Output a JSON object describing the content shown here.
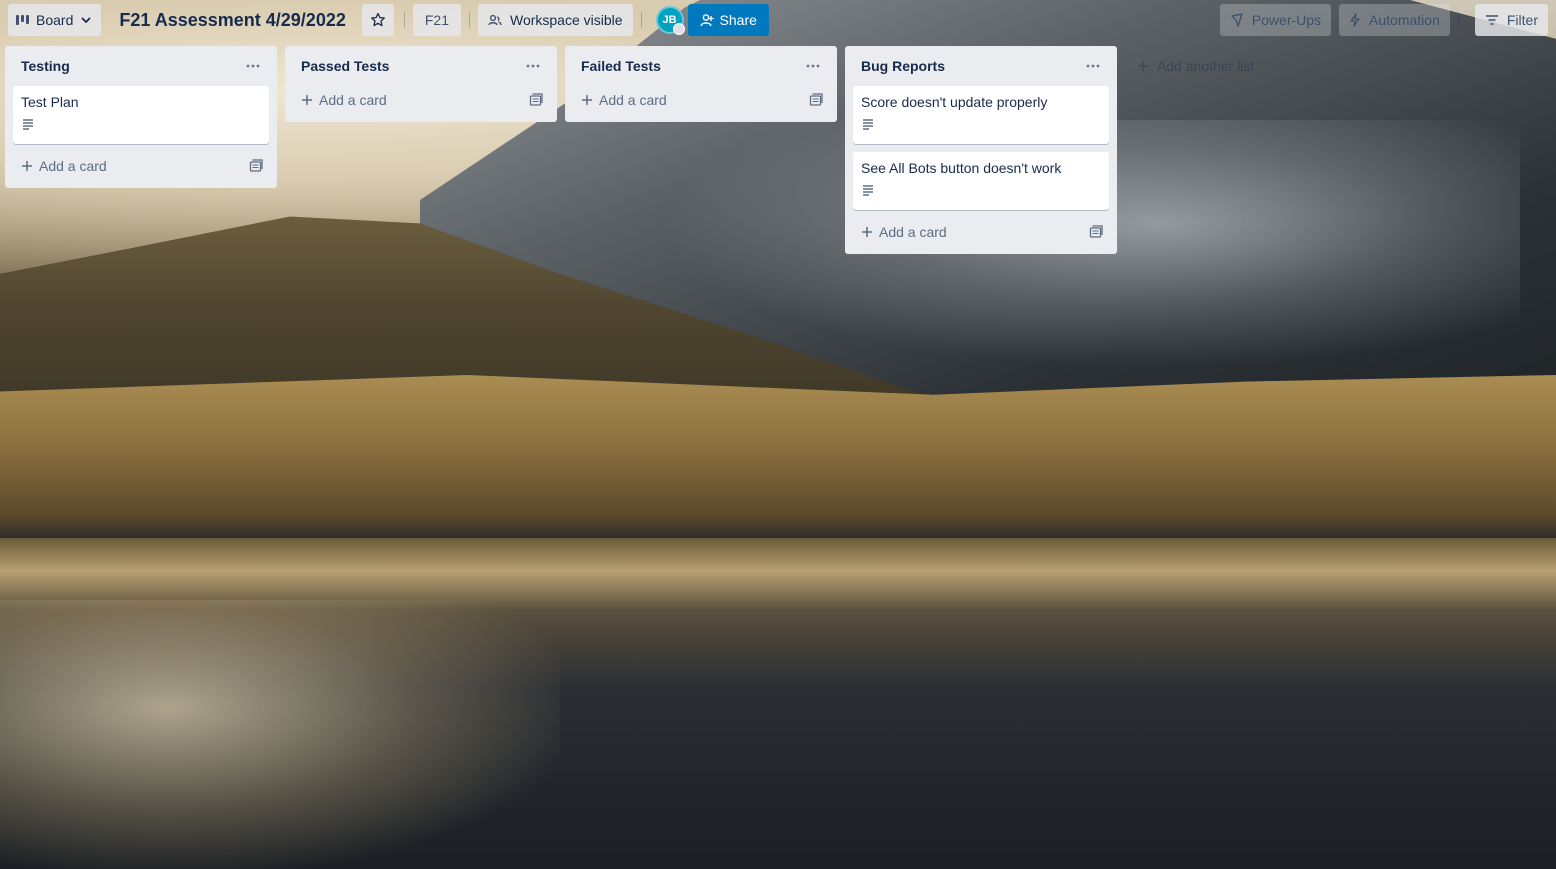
{
  "header": {
    "view_switcher": "Board",
    "board_title": "F21 Assessment 4/29/2022",
    "workspace_tag": "F21",
    "visibility": "Workspace visible",
    "member_initials": "JB",
    "share_label": "Share",
    "power_ups_label": "Power-Ups",
    "automation_label": "Automation",
    "filter_label": "Filter"
  },
  "lists": [
    {
      "title": "Testing",
      "cards": [
        {
          "title": "Test Plan",
          "has_description": true
        }
      ],
      "add_card_label": "Add a card"
    },
    {
      "title": "Passed Tests",
      "cards": [],
      "add_card_label": "Add a card"
    },
    {
      "title": "Failed Tests",
      "cards": [],
      "add_card_label": "Add a card"
    },
    {
      "title": "Bug Reports",
      "cards": [
        {
          "title": "Score doesn't update properly",
          "has_description": true
        },
        {
          "title": "See All Bots button doesn't work",
          "has_description": true
        }
      ],
      "add_card_label": "Add a card"
    }
  ],
  "add_list_label": "Add another list",
  "icons": [
    "board-icon",
    "chevron-down-icon",
    "star-icon",
    "workspace-icon",
    "share-user-icon",
    "power-ups-icon",
    "automation-icon",
    "filter-icon",
    "list-menu-icon",
    "description-icon",
    "plus-icon",
    "template-icon"
  ],
  "colors": {
    "share": "#0079bf",
    "avatar": "#00a3bf",
    "list_bg": "#ebecf0",
    "text": "#172b4d"
  }
}
